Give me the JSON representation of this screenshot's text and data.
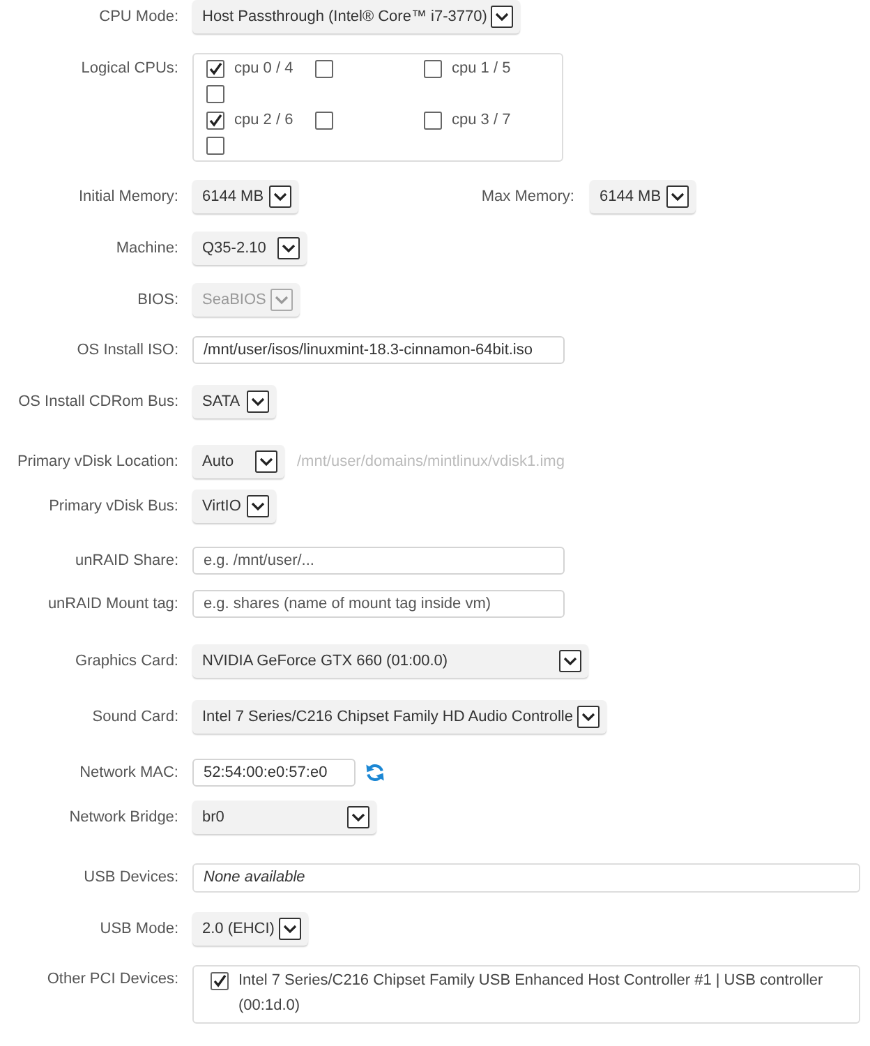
{
  "rows": [
    {
      "kind": "select",
      "label": "CPU Mode:",
      "value": "Host Passthrough (Intel® Core™ i7-3770)",
      "disabled": false
    },
    {
      "kind": "checkbox_grid",
      "label": "Logical CPUs:",
      "items": [
        {
          "label": "cpu 0 / 4",
          "checked": true
        },
        {
          "checked": false
        },
        {
          "label": "cpu 1 / 5",
          "checked": false
        },
        {
          "checked": false
        },
        {
          "label": "cpu 2 / 6",
          "checked": true
        },
        {
          "checked": false
        },
        {
          "label": "cpu 3 / 7",
          "checked": false
        },
        {
          "checked": false
        }
      ]
    },
    {
      "kind": "select_pair",
      "fields": [
        {
          "label": "Initial Memory:",
          "value": "6144 MB",
          "disabled": false
        },
        {
          "label": "Max Memory:",
          "value": "6144 MB",
          "disabled": false
        }
      ]
    },
    {
      "kind": "select",
      "label": "Machine:",
      "value": "Q35-2.10",
      "disabled": false
    },
    {
      "kind": "select",
      "label": "BIOS:",
      "value": "SeaBIOS",
      "disabled": true
    },
    {
      "kind": "input",
      "label": "OS Install ISO:",
      "value": "/mnt/user/isos/linuxmint-18.3-cinnamon-64bit.iso"
    },
    {
      "kind": "select",
      "label": "OS Install CDRom Bus:",
      "value": "SATA",
      "disabled": false
    },
    {
      "kind": "select",
      "label": "Primary vDisk Location:",
      "value": "Auto",
      "disabled": false,
      "note": "/mnt/user/domains/mintlinux/vdisk1.img"
    },
    {
      "kind": "select",
      "label": "Primary vDisk Bus:",
      "value": "VirtIO",
      "disabled": false
    },
    {
      "kind": "input",
      "label": "unRAID Share:",
      "placeholder": "e.g. /mnt/user/..."
    },
    {
      "kind": "input",
      "label": "unRAID Mount tag:",
      "placeholder": "e.g. shares (name of mount tag inside vm)"
    },
    {
      "kind": "select",
      "label": "Graphics Card:",
      "value": "NVIDIA GeForce GTX 660 (01:00.0)",
      "disabled": false
    },
    {
      "kind": "select",
      "label": "Sound Card:",
      "value": "Intel 7 Series/C216 Chipset Family HD Audio Controlle",
      "disabled": false
    },
    {
      "kind": "input",
      "label": "Network MAC:",
      "value": "52:54:00:e0:57:e0",
      "refresh_button": true
    },
    {
      "kind": "select",
      "label": "Network Bridge:",
      "value": "br0",
      "disabled": false
    },
    {
      "kind": "list",
      "label": "USB Devices:",
      "empty_text": "None available"
    },
    {
      "kind": "select",
      "label": "USB Mode:",
      "value": "2.0 (EHCI)",
      "disabled": false
    },
    {
      "kind": "checklist",
      "label": "Other PCI Devices:",
      "items": [
        {
          "label": "Intel 7 Series/C216 Chipset Family USB Enhanced Host Controller #1 | USB controller (00:1d.0)",
          "checked": true
        }
      ]
    }
  ]
}
